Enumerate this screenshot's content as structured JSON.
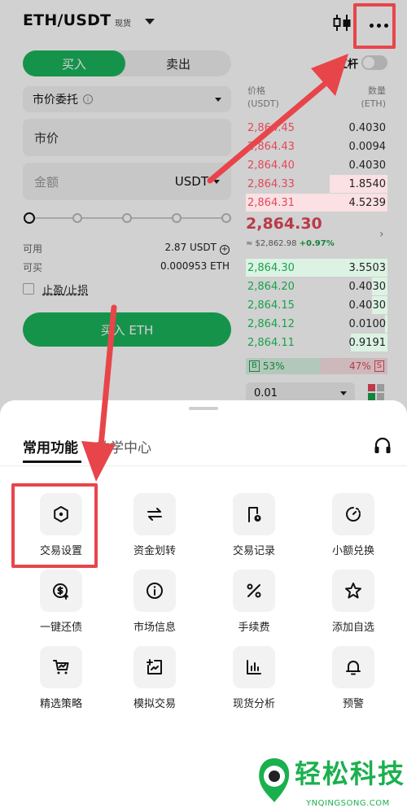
{
  "header": {
    "pair": "ETH/USDT",
    "market_tag": "现货"
  },
  "trade_tabs": {
    "buy": "买入",
    "sell": "卖出"
  },
  "leverage": {
    "label": "杠杆",
    "enabled": false
  },
  "form": {
    "order_type": "市价委托",
    "price_placeholder": "市价",
    "amount_placeholder": "金额",
    "amount_unit": "USDT",
    "available_label": "可用",
    "available_value": "2.87 USDT",
    "can_buy_label": "可买",
    "can_buy_value": "0.000953 ETH",
    "tp_sl_label": "止盈/止损",
    "buy_button": "买入 ETH"
  },
  "order_book": {
    "price_header": "价格",
    "price_unit": "(USDT)",
    "qty_header": "数量",
    "qty_unit": "(ETH)",
    "asks": [
      {
        "price": "2,864.45",
        "qty": "0.4030",
        "depth": 0.0
      },
      {
        "price": "2,864.43",
        "qty": "0.0094",
        "depth": 0.0
      },
      {
        "price": "2,864.40",
        "qty": "0.4030",
        "depth": 0.0
      },
      {
        "price": "2,864.33",
        "qty": "1.8540",
        "depth": 0.41
      },
      {
        "price": "2,864.31",
        "qty": "4.5239",
        "depth": 1.0
      }
    ],
    "last_price": "2,864.30",
    "last_sub_prefix": "≈ $2,862.98",
    "last_change": "+0.97%",
    "bids": [
      {
        "price": "2,864.30",
        "qty": "3.5503",
        "depth": 1.0
      },
      {
        "price": "2,864.20",
        "qty": "0.4030",
        "depth": 0.11
      },
      {
        "price": "2,864.15",
        "qty": "0.4030",
        "depth": 0.11
      },
      {
        "price": "2,864.12",
        "qty": "0.0100",
        "depth": 0.02
      },
      {
        "price": "2,864.11",
        "qty": "0.9191",
        "depth": 0.26
      }
    ],
    "buy_ratio_tag": "B",
    "buy_ratio": "53%",
    "sell_ratio": "47%",
    "sell_ratio_tag": "S",
    "depth_select": "0.01"
  },
  "sheet": {
    "tab_active": "常用功能",
    "tab_other": "教学中心",
    "functions": [
      {
        "label": "交易设置",
        "icon": "hexagon-settings-icon"
      },
      {
        "label": "资金划转",
        "icon": "transfer-arrows-icon"
      },
      {
        "label": "交易记录",
        "icon": "record-clock-icon"
      },
      {
        "label": "小额兑换",
        "icon": "small-exchange-icon"
      },
      {
        "label": "一键还债",
        "icon": "repay-coin-icon"
      },
      {
        "label": "市场信息",
        "icon": "info-icon"
      },
      {
        "label": "手续费",
        "icon": "percent-icon"
      },
      {
        "label": "添加自选",
        "icon": "star-icon"
      },
      {
        "label": "精选策略",
        "icon": "strategy-cart-icon"
      },
      {
        "label": "模拟交易",
        "icon": "demo-trade-icon"
      },
      {
        "label": "现货分析",
        "icon": "bar-analysis-icon"
      },
      {
        "label": "预警",
        "icon": "bell-icon"
      }
    ]
  },
  "watermark": {
    "text": "轻松科技",
    "sub": "YNQINGSONG.COM"
  },
  "colors": {
    "green": "#1bb45c",
    "red": "#e54759",
    "annotation": "#e8454b"
  }
}
